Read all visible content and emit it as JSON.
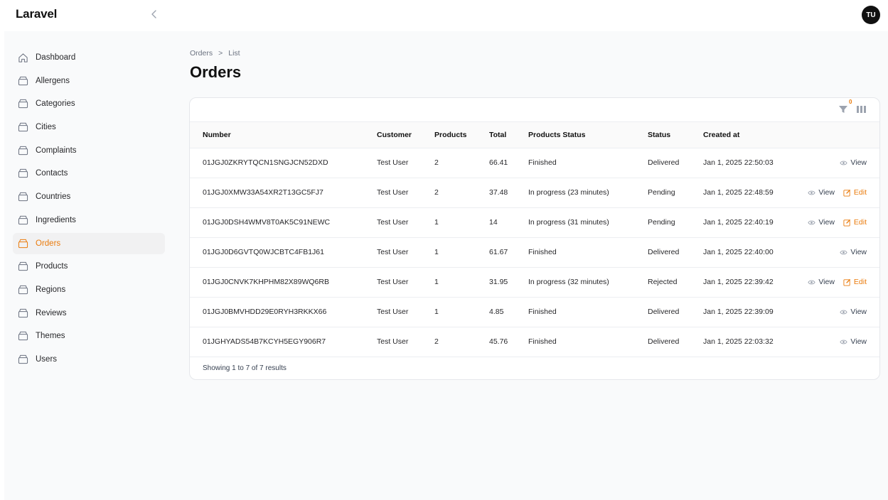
{
  "app": {
    "brand": "Laravel",
    "avatar_initials": "TU"
  },
  "sidebar": {
    "items": [
      {
        "label": "Dashboard",
        "icon": "home-icon",
        "active": false
      },
      {
        "label": "Allergens",
        "icon": "box-icon",
        "active": false
      },
      {
        "label": "Categories",
        "icon": "box-icon",
        "active": false
      },
      {
        "label": "Cities",
        "icon": "box-icon",
        "active": false
      },
      {
        "label": "Complaints",
        "icon": "box-icon",
        "active": false
      },
      {
        "label": "Contacts",
        "icon": "box-icon",
        "active": false
      },
      {
        "label": "Countries",
        "icon": "box-icon",
        "active": false
      },
      {
        "label": "Ingredients",
        "icon": "box-icon",
        "active": false
      },
      {
        "label": "Orders",
        "icon": "box-icon",
        "active": true
      },
      {
        "label": "Products",
        "icon": "box-icon",
        "active": false
      },
      {
        "label": "Regions",
        "icon": "box-icon",
        "active": false
      },
      {
        "label": "Reviews",
        "icon": "box-icon",
        "active": false
      },
      {
        "label": "Themes",
        "icon": "box-icon",
        "active": false
      },
      {
        "label": "Users",
        "icon": "box-icon",
        "active": false
      }
    ]
  },
  "breadcrumb": {
    "root": "Orders",
    "separator": ">",
    "current": "List"
  },
  "page": {
    "title": "Orders"
  },
  "toolbar": {
    "filter_count": "0"
  },
  "table": {
    "headers": {
      "number": "Number",
      "customer": "Customer",
      "products": "Products",
      "total": "Total",
      "products_status": "Products Status",
      "status": "Status",
      "created_at": "Created at"
    },
    "action_labels": {
      "view": "View",
      "edit": "Edit"
    },
    "rows": [
      {
        "number": "01JGJ0ZKRYTQCN1SNGJCN52DXD",
        "customer": "Test User",
        "products": "2",
        "total": "66.41",
        "products_status": "Finished",
        "status": "Delivered",
        "created_at": "Jan 1, 2025 22:50:03",
        "editable": false
      },
      {
        "number": "01JGJ0XMW33A54XR2T13GC5FJ7",
        "customer": "Test User",
        "products": "2",
        "total": "37.48",
        "products_status": "In progress (23 minutes)",
        "status": "Pending",
        "created_at": "Jan 1, 2025 22:48:59",
        "editable": true
      },
      {
        "number": "01JGJ0DSH4WMV8T0AK5C91NEWC",
        "customer": "Test User",
        "products": "1",
        "total": "14",
        "products_status": "In progress (31 minutes)",
        "status": "Pending",
        "created_at": "Jan 1, 2025 22:40:19",
        "editable": true
      },
      {
        "number": "01JGJ0D6GVTQ0WJCBTC4FB1J61",
        "customer": "Test User",
        "products": "1",
        "total": "61.67",
        "products_status": "Finished",
        "status": "Delivered",
        "created_at": "Jan 1, 2025 22:40:00",
        "editable": false
      },
      {
        "number": "01JGJ0CNVK7KHPHM82X89WQ6RB",
        "customer": "Test User",
        "products": "1",
        "total": "31.95",
        "products_status": "In progress (32 minutes)",
        "status": "Rejected",
        "created_at": "Jan 1, 2025 22:39:42",
        "editable": true
      },
      {
        "number": "01JGJ0BMVHDD29E0RYH3RKKX66",
        "customer": "Test User",
        "products": "1",
        "total": "4.85",
        "products_status": "Finished",
        "status": "Delivered",
        "created_at": "Jan 1, 2025 22:39:09",
        "editable": false
      },
      {
        "number": "01JGHYADS54B7KCYH5EGY906R7",
        "customer": "Test User",
        "products": "2",
        "total": "45.76",
        "products_status": "Finished",
        "status": "Delivered",
        "created_at": "Jan 1, 2025 22:03:32",
        "editable": false
      }
    ],
    "footer_text": "Showing 1 to 7 of 7 results"
  },
  "colors": {
    "accent": "#ea7b0c",
    "background": "#f9fafb",
    "active_bg": "#f1f1f2"
  }
}
